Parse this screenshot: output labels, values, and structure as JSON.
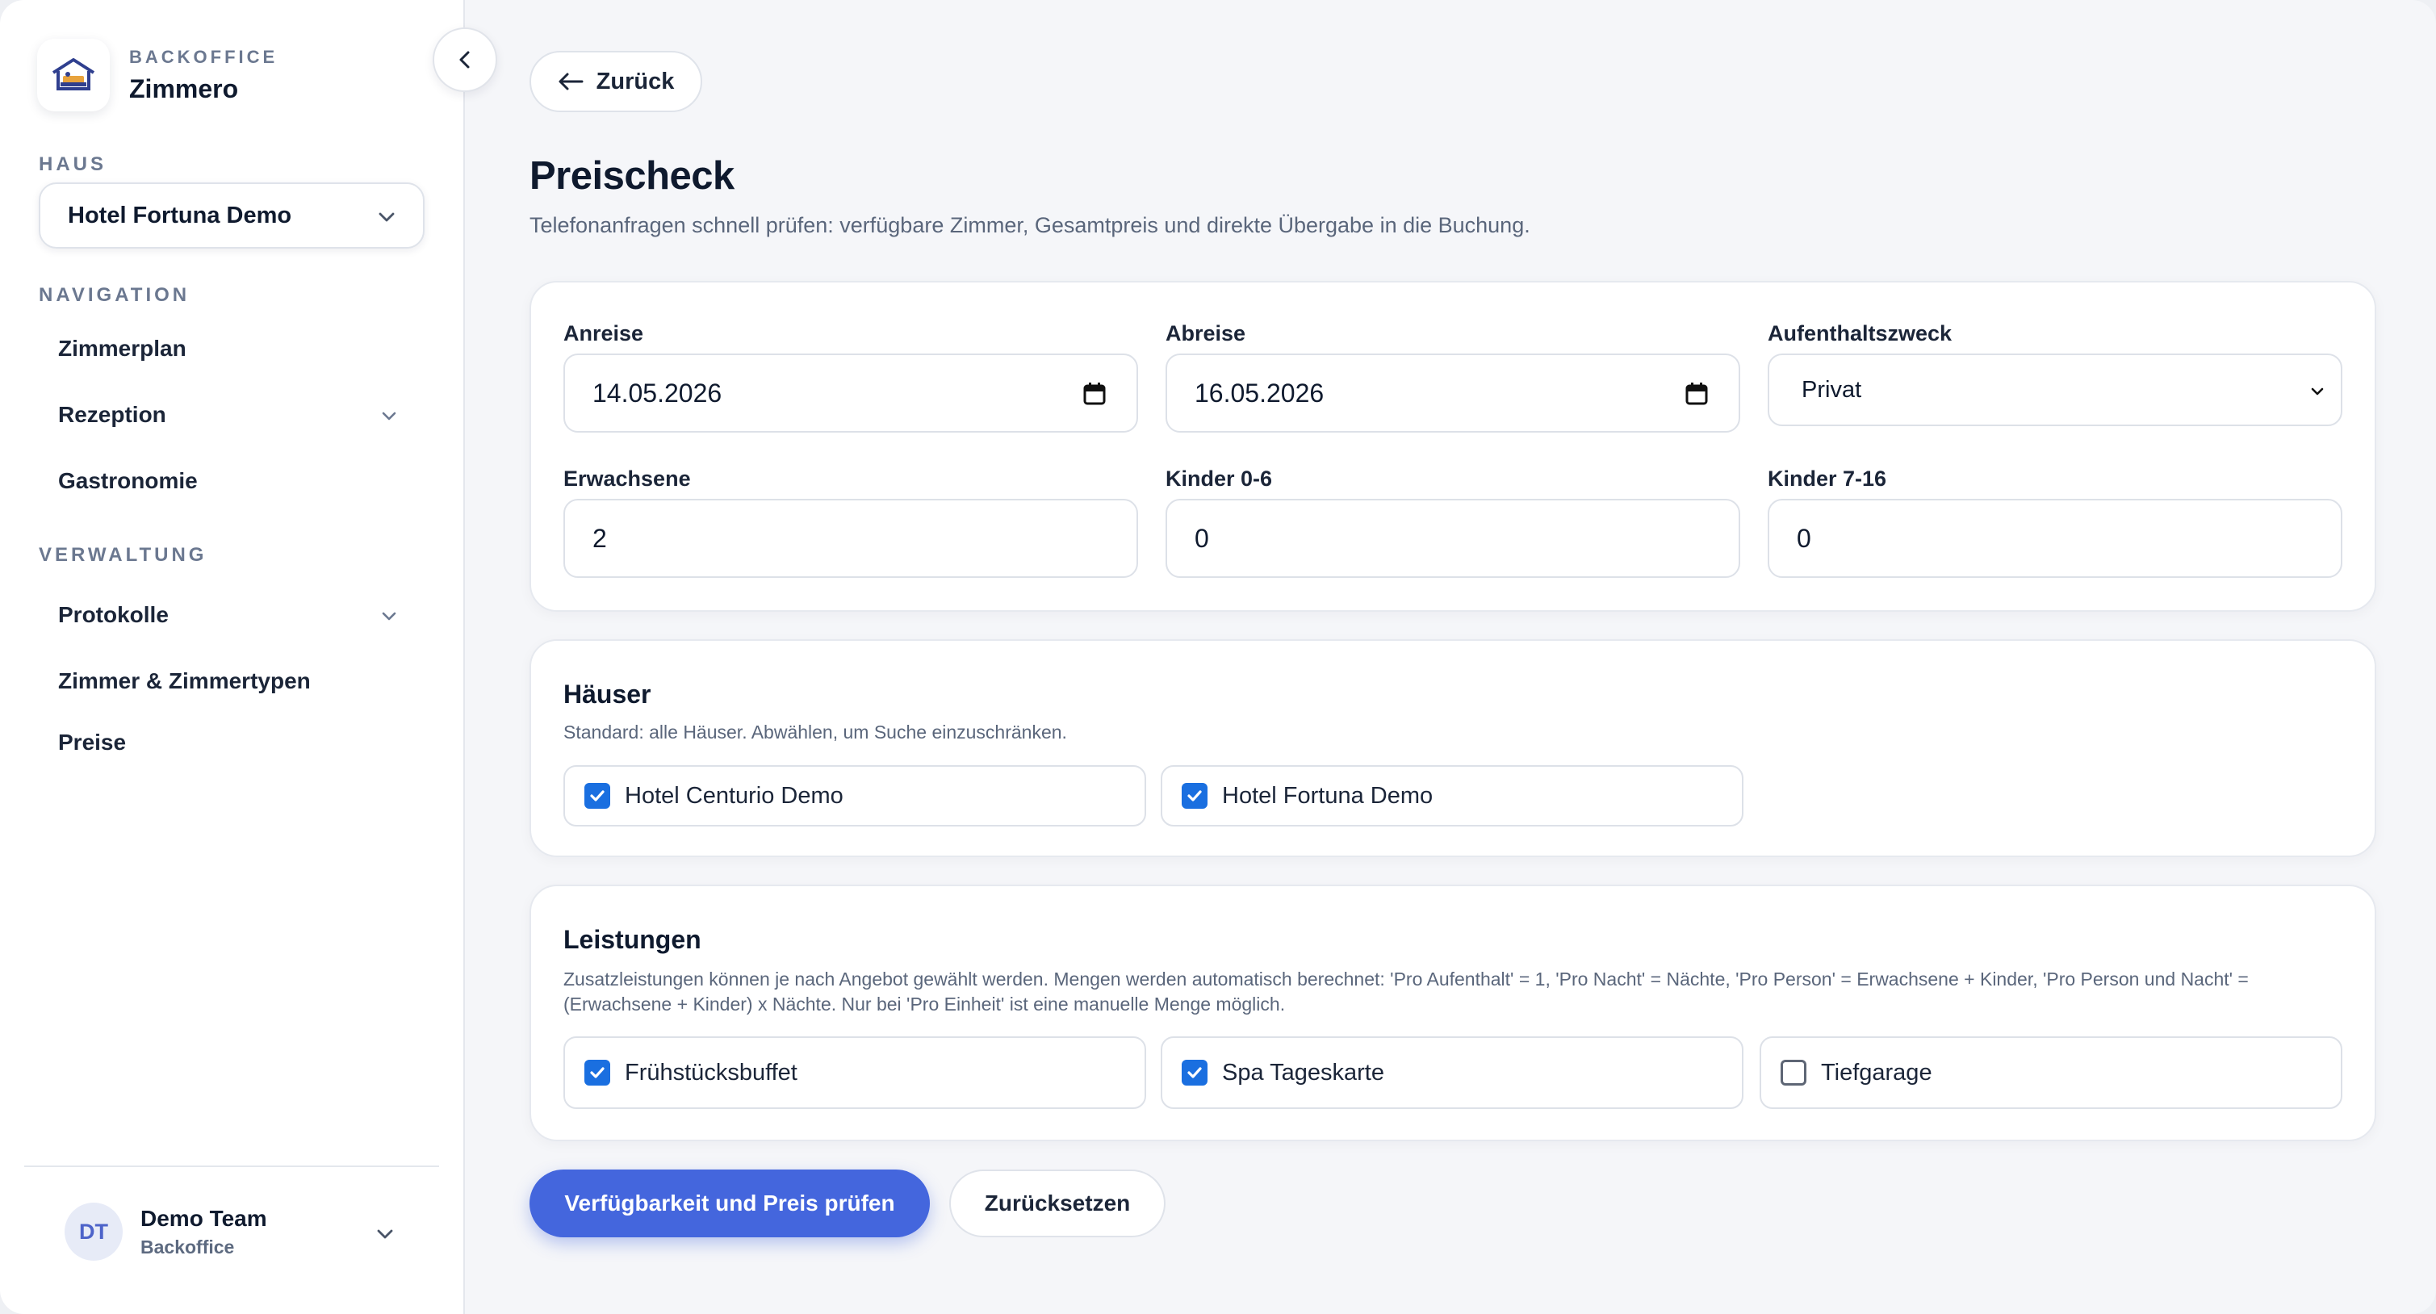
{
  "brand": {
    "eyebrow": "BACKOFFICE",
    "name": "Zimmero",
    "logo_icon": "hotel-logo-icon"
  },
  "sidebar": {
    "house_section_label": "HAUS",
    "house_selected": "Hotel Fortuna Demo",
    "navigation_label": "NAVIGATION",
    "navigation_items": [
      {
        "label": "Zimmerplan",
        "expandable": false
      },
      {
        "label": "Rezeption",
        "expandable": true
      },
      {
        "label": "Gastronomie",
        "expandable": false
      }
    ],
    "admin_label": "VERWALTUNG",
    "admin_items": [
      {
        "label": "Protokolle",
        "expandable": true
      },
      {
        "label": "Zimmer & Zimmertypen",
        "expandable": false
      },
      {
        "label": "Preise",
        "expandable": false
      }
    ],
    "user": {
      "initials": "DT",
      "name": "Demo Team",
      "role": "Backoffice"
    }
  },
  "main": {
    "back_label": "Zurück",
    "title": "Preischeck",
    "subtitle": "Telefonanfragen schnell prüfen: verfügbare Zimmer, Gesamtpreis und direkte Übergabe in die Buchung.",
    "form": {
      "arrival": {
        "label": "Anreise",
        "value": "14.05.2026"
      },
      "departure": {
        "label": "Abreise",
        "value": "16.05.2026"
      },
      "purpose": {
        "label": "Aufenthaltszweck",
        "value": "Privat"
      },
      "adults": {
        "label": "Erwachsene",
        "value": "2"
      },
      "children_0_6": {
        "label": "Kinder 0-6",
        "value": "0"
      },
      "children_7_16": {
        "label": "Kinder 7-16",
        "value": "0"
      }
    },
    "houses": {
      "title": "Häuser",
      "description": "Standard: alle Häuser. Abwählen, um Suche einzuschränken.",
      "options": [
        {
          "label": "Hotel Centurio Demo",
          "checked": true
        },
        {
          "label": "Hotel Fortuna Demo",
          "checked": true
        }
      ]
    },
    "services": {
      "title": "Leistungen",
      "description": "Zusatzleistungen können je nach Angebot gewählt werden. Mengen werden automatisch berechnet: 'Pro Aufenthalt' = 1, 'Pro Nacht' = Nächte, 'Pro Person' = Erwachsene + Kinder, 'Pro Person und Nacht' = (Erwachsene + Kinder) x Nächte. Nur bei 'Pro Einheit' ist eine manuelle Menge möglich.",
      "options": [
        {
          "label": "Frühstücksbuffet",
          "checked": true
        },
        {
          "label": "Spa Tageskarte",
          "checked": true
        },
        {
          "label": "Tiefgarage",
          "checked": false
        }
      ]
    },
    "actions": {
      "check_label": "Verfügbarkeit und Preis prüfen",
      "reset_label": "Zurücksetzen"
    }
  },
  "colors": {
    "accent": "#4466dd",
    "checkbox": "#1a6fe0",
    "text": "#0f1a2e",
    "muted": "#5a667b"
  }
}
